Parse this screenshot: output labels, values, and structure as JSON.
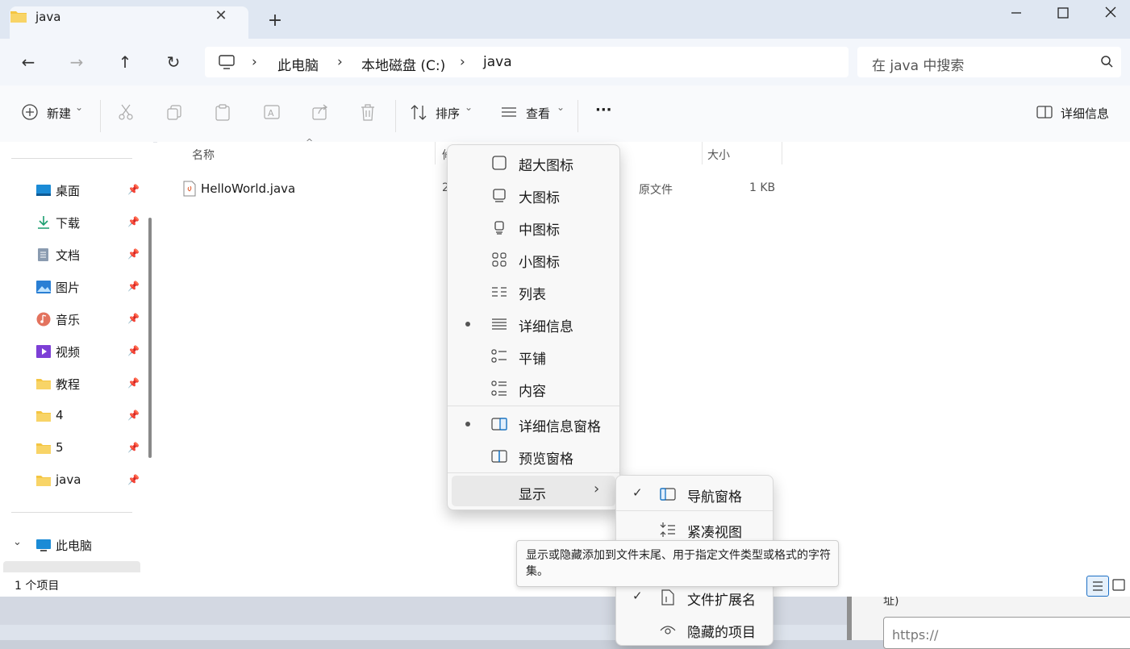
{
  "tab": {
    "title": "java",
    "close": "✕",
    "new_tab": "+"
  },
  "window_controls": {
    "minimize": "—",
    "maximize": "☐",
    "close": "✕"
  },
  "nav": {
    "back": "←",
    "forward": "→",
    "up": "↑",
    "refresh": "↻"
  },
  "address": {
    "crumbs": [
      "此电脑",
      "本地磁盘 (C:)",
      "java"
    ],
    "sep": "›"
  },
  "search": {
    "placeholder": "在 java 中搜索"
  },
  "toolbar": {
    "new_label": "新建",
    "sort_label": "排序",
    "view_label": "查看",
    "more": "···",
    "details_label": "详细信息",
    "caret": "⌄"
  },
  "sidebar": {
    "items": [
      {
        "label": "桌面",
        "icon": "desktop-icon"
      },
      {
        "label": "下载",
        "icon": "download-icon"
      },
      {
        "label": "文档",
        "icon": "documents-icon"
      },
      {
        "label": "图片",
        "icon": "pictures-icon"
      },
      {
        "label": "音乐",
        "icon": "music-icon"
      },
      {
        "label": "视频",
        "icon": "videos-icon"
      },
      {
        "label": "教程",
        "icon": "folder-icon"
      },
      {
        "label": "4",
        "icon": "folder-icon"
      },
      {
        "label": "5",
        "icon": "folder-icon"
      },
      {
        "label": "java",
        "icon": "folder-icon"
      }
    ],
    "this_pc": "此电脑",
    "expand": "⌄"
  },
  "file_list": {
    "columns": {
      "name": "名称",
      "date": "修",
      "size": "大小"
    },
    "files": [
      {
        "name": "HelloWorld.java",
        "date": "2",
        "type": "原文件",
        "size": "1 KB"
      }
    ]
  },
  "status": {
    "count": "1 个项目"
  },
  "view_menu": {
    "items": [
      {
        "label": "超大图标",
        "selected": false
      },
      {
        "label": "大图标",
        "selected": false
      },
      {
        "label": "中图标",
        "selected": false
      },
      {
        "label": "小图标",
        "selected": false
      },
      {
        "label": "列表",
        "selected": false
      },
      {
        "label": "详细信息",
        "selected": true
      },
      {
        "label": "平铺",
        "selected": false
      },
      {
        "label": "内容",
        "selected": false
      },
      {
        "label": "详细信息窗格",
        "selected": true
      },
      {
        "label": "预览窗格",
        "selected": false
      }
    ],
    "show": "显示",
    "submenu_arrow": "›"
  },
  "show_menu": {
    "items": [
      {
        "label": "导航窗格",
        "checked": true
      },
      {
        "label": "紧凑视图",
        "checked": false
      },
      {
        "label": "文件扩展名",
        "checked": true
      },
      {
        "label": "隐藏的项目",
        "checked": false
      }
    ],
    "check": "✓"
  },
  "tooltip": {
    "text": "显示或隐藏添加到文件末尾、用于指定文件类型或格式的字符集。"
  },
  "background": {
    "label": "址)",
    "input_placeholder": "https://"
  },
  "colors": {
    "accent": "#0067c0",
    "folder": "#f4c542",
    "titlebar": "#dfe7f2"
  }
}
